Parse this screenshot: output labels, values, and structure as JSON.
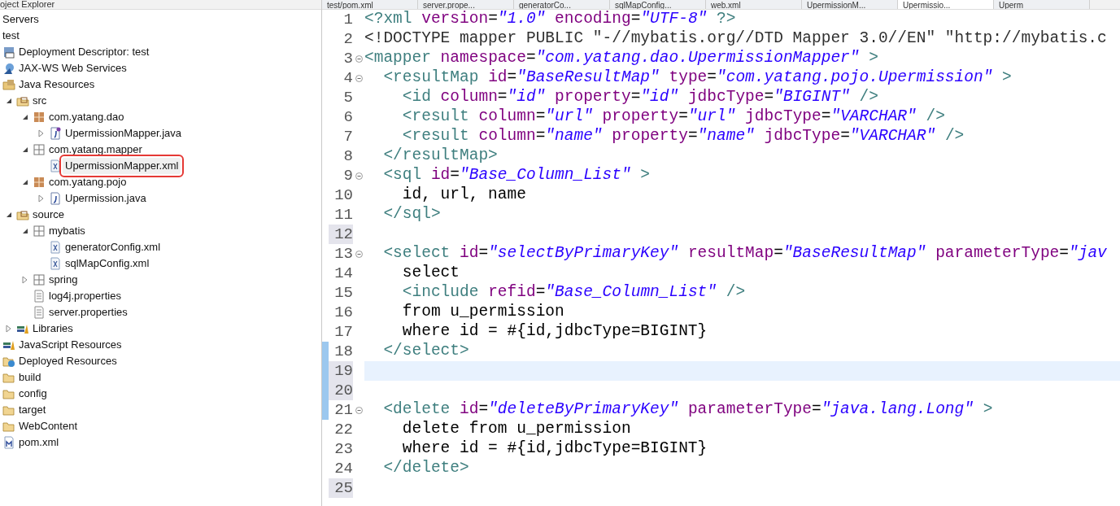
{
  "explorer": {
    "title": "oject Explorer",
    "items": [
      {
        "label": "Servers",
        "kind": "plain",
        "selected": false
      },
      {
        "label": "test",
        "kind": "plain",
        "selected": false
      },
      {
        "label": "Deployment Descriptor: test",
        "kind": "descriptor",
        "selected": false
      },
      {
        "label": "JAX-WS Web Services",
        "kind": "webservice",
        "selected": false
      },
      {
        "label": "Java Resources",
        "kind": "resources",
        "selected": false,
        "children": [
          {
            "label": "src",
            "kind": "srcfolder",
            "expanded": true,
            "selected": false,
            "children": [
              {
                "label": "com.yatang.dao",
                "kind": "package",
                "expanded": true,
                "selected": false,
                "children": [
                  {
                    "label": "UpermissionMapper.java",
                    "kind": "interface",
                    "expanded": false,
                    "selected": false
                  }
                ]
              },
              {
                "label": "com.yatang.mapper",
                "kind": "emptypackage",
                "expanded": true,
                "selected": false,
                "children": [
                  {
                    "label": "UpermissionMapper.xml",
                    "kind": "xml",
                    "selected": true
                  }
                ]
              },
              {
                "label": "com.yatang.pojo",
                "kind": "package",
                "expanded": true,
                "selected": false,
                "children": [
                  {
                    "label": "Upermission.java",
                    "kind": "class",
                    "expanded": false,
                    "selected": false
                  }
                ]
              }
            ]
          },
          {
            "label": "source",
            "kind": "srcfolder",
            "expanded": true,
            "selected": false,
            "children": [
              {
                "label": "mybatis",
                "kind": "emptypackage",
                "expanded": true,
                "selected": false,
                "children": [
                  {
                    "label": "generatorConfig.xml",
                    "kind": "xml",
                    "selected": false
                  },
                  {
                    "label": "sqlMapConfig.xml",
                    "kind": "xml",
                    "selected": false
                  }
                ]
              },
              {
                "label": "spring",
                "kind": "emptypackage",
                "expanded": false,
                "selected": false
              },
              {
                "label": "log4j.properties",
                "kind": "text",
                "selected": false
              },
              {
                "label": "server.properties",
                "kind": "text",
                "selected": false
              }
            ]
          },
          {
            "label": "Libraries",
            "kind": "library",
            "expanded": false,
            "selected": false
          }
        ]
      },
      {
        "label": "JavaScript Resources",
        "kind": "library",
        "selected": false
      },
      {
        "label": "Deployed Resources",
        "kind": "deployed",
        "selected": false
      },
      {
        "label": "build",
        "kind": "folder",
        "selected": false
      },
      {
        "label": "config",
        "kind": "folder",
        "selected": false
      },
      {
        "label": "target",
        "kind": "folder",
        "selected": false
      },
      {
        "label": "WebContent",
        "kind": "folder",
        "selected": false
      },
      {
        "label": "pom.xml",
        "kind": "maven",
        "selected": false
      }
    ]
  },
  "editor_tabs": [
    {
      "label": "test/pom.xml",
      "selected": false
    },
    {
      "label": "server.prope...",
      "selected": false
    },
    {
      "label": "generatorCo...",
      "selected": false
    },
    {
      "label": "sqlMapConfig...",
      "selected": false
    },
    {
      "label": "web.xml",
      "selected": false
    },
    {
      "label": "UpermissionM...",
      "selected": false
    },
    {
      "label": "Upermissio...",
      "selected": true
    },
    {
      "label": "Uperm",
      "selected": false
    }
  ],
  "editor_lines": [
    {
      "number": "1",
      "foldable": false,
      "changed": false,
      "current": false,
      "segments": [
        {
          "kind": "tag",
          "text": "<?xml"
        },
        {
          "kind": "attr",
          "text": " version"
        },
        {
          "kind": "text",
          "text": "="
        },
        {
          "kind": "value",
          "text": "\"1.0\""
        },
        {
          "kind": "attr",
          "text": " encoding"
        },
        {
          "kind": "text",
          "text": "="
        },
        {
          "kind": "value",
          "text": "\"UTF-8\""
        },
        {
          "kind": "tag",
          "text": " ?>"
        }
      ]
    },
    {
      "number": "2",
      "foldable": false,
      "changed": false,
      "current": false,
      "segments": [
        {
          "kind": "doctype",
          "text": "<!DOCTYPE mapper PUBLIC \"-//mybatis.org//DTD Mapper 3.0//EN\" \"http://mybatis.c"
        }
      ]
    },
    {
      "number": "3",
      "foldable": true,
      "changed": false,
      "current": false,
      "segments": [
        {
          "kind": "tag",
          "text": "<mapper"
        },
        {
          "kind": "attr",
          "text": " namespace"
        },
        {
          "kind": "text",
          "text": "="
        },
        {
          "kind": "value",
          "text": "\"com.yatang.dao.UpermissionMapper\""
        },
        {
          "kind": "tag",
          "text": " >"
        }
      ]
    },
    {
      "number": "4",
      "foldable": true,
      "changed": false,
      "current": false,
      "segments": [
        {
          "kind": "tag",
          "text": "  <resultMap"
        },
        {
          "kind": "attr",
          "text": " id"
        },
        {
          "kind": "text",
          "text": "="
        },
        {
          "kind": "value",
          "text": "\"BaseResultMap\""
        },
        {
          "kind": "attr",
          "text": " type"
        },
        {
          "kind": "text",
          "text": "="
        },
        {
          "kind": "value",
          "text": "\"com.yatang.pojo.Upermission\""
        },
        {
          "kind": "tag",
          "text": " >"
        }
      ]
    },
    {
      "number": "5",
      "foldable": false,
      "changed": false,
      "current": false,
      "segments": [
        {
          "kind": "tag",
          "text": "    <id"
        },
        {
          "kind": "attr",
          "text": " column"
        },
        {
          "kind": "text",
          "text": "="
        },
        {
          "kind": "value",
          "text": "\"id\""
        },
        {
          "kind": "attr",
          "text": " property"
        },
        {
          "kind": "text",
          "text": "="
        },
        {
          "kind": "value",
          "text": "\"id\""
        },
        {
          "kind": "attr",
          "text": " jdbcType"
        },
        {
          "kind": "text",
          "text": "="
        },
        {
          "kind": "value",
          "text": "\"BIGINT\""
        },
        {
          "kind": "tag",
          "text": " />"
        }
      ]
    },
    {
      "number": "6",
      "foldable": false,
      "changed": false,
      "current": false,
      "segments": [
        {
          "kind": "tag",
          "text": "    <result"
        },
        {
          "kind": "attr",
          "text": " column"
        },
        {
          "kind": "text",
          "text": "="
        },
        {
          "kind": "value",
          "text": "\"url\""
        },
        {
          "kind": "attr",
          "text": " property"
        },
        {
          "kind": "text",
          "text": "="
        },
        {
          "kind": "value",
          "text": "\"url\""
        },
        {
          "kind": "attr",
          "text": " jdbcType"
        },
        {
          "kind": "text",
          "text": "="
        },
        {
          "kind": "value",
          "text": "\"VARCHAR\""
        },
        {
          "kind": "tag",
          "text": " />"
        }
      ]
    },
    {
      "number": "7",
      "foldable": false,
      "changed": false,
      "current": false,
      "segments": [
        {
          "kind": "tag",
          "text": "    <result"
        },
        {
          "kind": "attr",
          "text": " column"
        },
        {
          "kind": "text",
          "text": "="
        },
        {
          "kind": "value",
          "text": "\"name\""
        },
        {
          "kind": "attr",
          "text": " property"
        },
        {
          "kind": "text",
          "text": "="
        },
        {
          "kind": "value",
          "text": "\"name\""
        },
        {
          "kind": "attr",
          "text": " jdbcType"
        },
        {
          "kind": "text",
          "text": "="
        },
        {
          "kind": "value",
          "text": "\"VARCHAR\""
        },
        {
          "kind": "tag",
          "text": " />"
        }
      ]
    },
    {
      "number": "8",
      "foldable": false,
      "changed": false,
      "current": false,
      "segments": [
        {
          "kind": "tag",
          "text": "  </resultMap>"
        }
      ]
    },
    {
      "number": "9",
      "foldable": true,
      "changed": false,
      "current": false,
      "segments": [
        {
          "kind": "tag",
          "text": "  <sql"
        },
        {
          "kind": "attr",
          "text": " id"
        },
        {
          "kind": "text",
          "text": "="
        },
        {
          "kind": "value",
          "text": "\"Base_Column_List\""
        },
        {
          "kind": "tag",
          "text": " >"
        }
      ]
    },
    {
      "number": "10",
      "foldable": false,
      "changed": false,
      "current": false,
      "segments": [
        {
          "kind": "text",
          "text": "    id, url, name"
        }
      ]
    },
    {
      "number": "11",
      "foldable": false,
      "changed": false,
      "current": false,
      "segments": [
        {
          "kind": "tag",
          "text": "  </sql>"
        }
      ]
    },
    {
      "number": "12",
      "foldable": false,
      "changed": true,
      "current": false
    },
    {
      "number": "13",
      "foldable": true,
      "changed": false,
      "current": false,
      "segments": [
        {
          "kind": "tag",
          "text": "  <select"
        },
        {
          "kind": "attr",
          "text": " id"
        },
        {
          "kind": "text",
          "text": "="
        },
        {
          "kind": "value",
          "text": "\"selectByPrimaryKey\""
        },
        {
          "kind": "attr",
          "text": " resultMap"
        },
        {
          "kind": "text",
          "text": "="
        },
        {
          "kind": "value",
          "text": "\"BaseResultMap\""
        },
        {
          "kind": "attr",
          "text": " parameterType"
        },
        {
          "kind": "text",
          "text": "="
        },
        {
          "kind": "value",
          "text": "\"jav"
        }
      ]
    },
    {
      "number": "14",
      "foldable": false,
      "changed": false,
      "current": false,
      "segments": [
        {
          "kind": "text",
          "text": "    select"
        }
      ]
    },
    {
      "number": "15",
      "foldable": false,
      "changed": false,
      "current": false,
      "segments": [
        {
          "kind": "tag",
          "text": "    <include"
        },
        {
          "kind": "attr",
          "text": " refid"
        },
        {
          "kind": "text",
          "text": "="
        },
        {
          "kind": "value",
          "text": "\"Base_Column_List\""
        },
        {
          "kind": "tag",
          "text": " />"
        }
      ]
    },
    {
      "number": "16",
      "foldable": false,
      "changed": false,
      "current": false,
      "segments": [
        {
          "kind": "text",
          "text": "    from u_permission"
        }
      ]
    },
    {
      "number": "17",
      "foldable": false,
      "changed": false,
      "current": false,
      "segments": [
        {
          "kind": "text",
          "text": "    where id = #{id,jdbcType=BIGINT}"
        }
      ]
    },
    {
      "number": "18",
      "foldable": false,
      "changed": false,
      "current": false,
      "diff": true,
      "segments": [
        {
          "kind": "tag",
          "text": "  </select>"
        }
      ]
    },
    {
      "number": "19",
      "foldable": false,
      "changed": true,
      "current": true,
      "diff": true
    },
    {
      "number": "20",
      "foldable": false,
      "changed": true,
      "current": false,
      "diff": true
    },
    {
      "number": "21",
      "foldable": true,
      "changed": false,
      "current": false,
      "diff": true,
      "segments": [
        {
          "kind": "tag",
          "text": "  <delete"
        },
        {
          "kind": "attr",
          "text": " id"
        },
        {
          "kind": "text",
          "text": "="
        },
        {
          "kind": "value",
          "text": "\"deleteByPrimaryKey\""
        },
        {
          "kind": "attr",
          "text": " parameterType"
        },
        {
          "kind": "text",
          "text": "="
        },
        {
          "kind": "value",
          "text": "\"java.lang.Long\""
        },
        {
          "kind": "tag",
          "text": " >"
        }
      ]
    },
    {
      "number": "22",
      "foldable": false,
      "changed": false,
      "current": false,
      "segments": [
        {
          "kind": "text",
          "text": "    delete from u_permission"
        }
      ]
    },
    {
      "number": "23",
      "foldable": false,
      "changed": false,
      "current": false,
      "segments": [
        {
          "kind": "text",
          "text": "    where id = #{id,jdbcType=BIGINT}"
        }
      ]
    },
    {
      "number": "24",
      "foldable": false,
      "changed": false,
      "current": false,
      "segments": [
        {
          "kind": "tag",
          "text": "  </delete>"
        }
      ]
    },
    {
      "number": "25",
      "foldable": false,
      "changed": true,
      "current": false
    }
  ]
}
